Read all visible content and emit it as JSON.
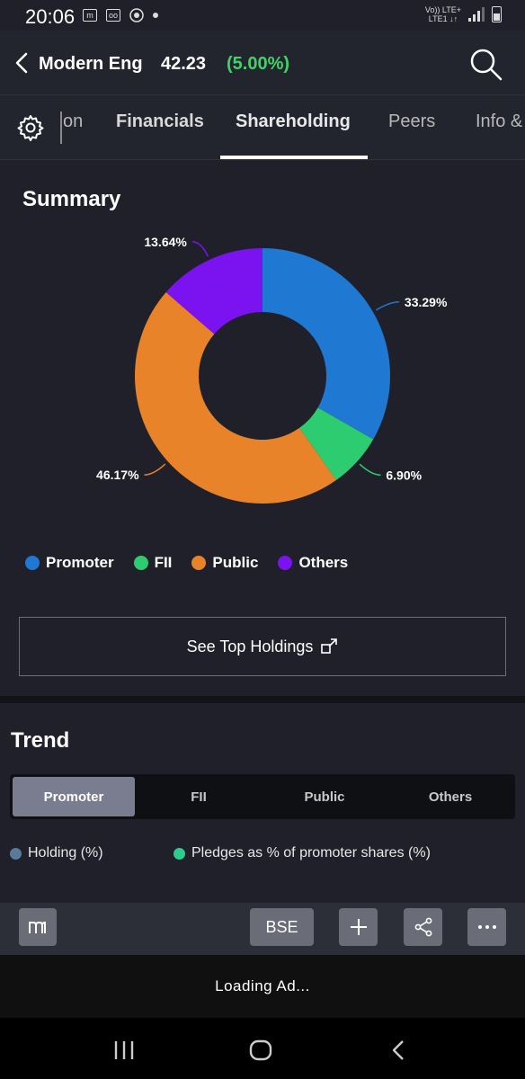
{
  "status": {
    "time": "20:06",
    "network_top": "Vo)) LTE+",
    "network_bottom": "LTE1 ↓↑"
  },
  "header": {
    "stock_name": "Modern Eng",
    "price": "42.23",
    "change": "(5.00%)",
    "change_color": "#44d168"
  },
  "tabs": [
    {
      "label": "on"
    },
    {
      "label": "Financials"
    },
    {
      "label": "Shareholding",
      "selected": true
    },
    {
      "label": "Peers"
    },
    {
      "label": "Info &"
    }
  ],
  "summary": {
    "title": "Summary",
    "legend": [
      {
        "label": "Promoter",
        "color": "#1f78d1"
      },
      {
        "label": "FII",
        "color": "#2ecc71"
      },
      {
        "label": "Public",
        "color": "#e8832a"
      },
      {
        "label": "Others",
        "color": "#7b12f0"
      }
    ],
    "see_top_holdings": "See Top Holdings"
  },
  "chart_data": {
    "type": "pie",
    "donut": true,
    "categories": [
      "Promoter",
      "FII",
      "Public",
      "Others"
    ],
    "values": [
      33.29,
      6.9,
      46.17,
      13.64
    ],
    "labels": [
      "33.29%",
      "6.90%",
      "46.17%",
      "13.64%"
    ],
    "colors": [
      "#1f78d1",
      "#2ecc71",
      "#e8832a",
      "#7b12f0"
    ],
    "legend_position": "bottom-left"
  },
  "trend": {
    "title": "Trend",
    "segments": [
      {
        "label": "Promoter",
        "active": true
      },
      {
        "label": "FII"
      },
      {
        "label": "Public"
      },
      {
        "label": "Others"
      }
    ],
    "legend": [
      {
        "label": "Holding (%)",
        "color": "#5a7a9a"
      },
      {
        "label": "Pledges as % of promoter shares (%)",
        "color": "#2ecc8a"
      }
    ]
  },
  "toolbar": {
    "exchange_label": "BSE"
  },
  "ad": {
    "label": "Loading Ad..."
  }
}
